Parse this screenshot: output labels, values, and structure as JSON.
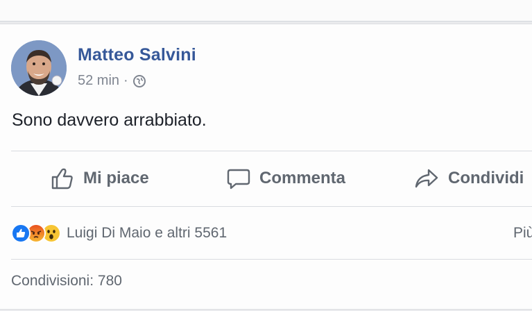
{
  "post": {
    "author": "Matteo Salvini",
    "time": "52 min",
    "separator": "·",
    "audience_icon": "globe-icon",
    "text": "Sono davvero arrabbiato."
  },
  "actions": {
    "like_label": "Mi piace",
    "comment_label": "Commenta",
    "share_label": "Condividi"
  },
  "reactions": {
    "icons": [
      "like-reaction-icon",
      "angry-reaction-icon",
      "wow-reaction-icon"
    ],
    "summary": "Luigi Di Maio e altri 5561",
    "more": "Più"
  },
  "shares": {
    "label": "Condivisioni: 780"
  },
  "colors": {
    "author_link": "#365899",
    "secondary_text": "#606770",
    "like_blue": "#1877f2",
    "angry_orange": "#f0702a",
    "wow_yellow": "#f7c534"
  }
}
